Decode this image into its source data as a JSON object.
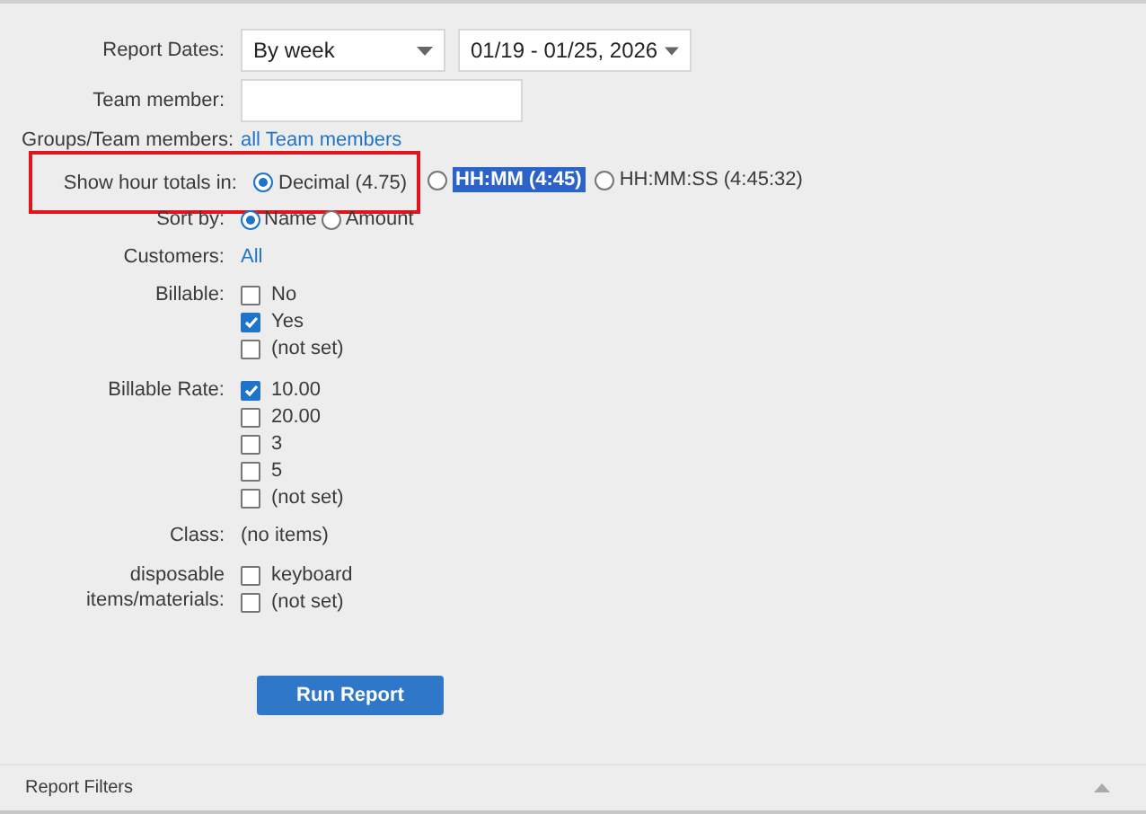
{
  "report_dates": {
    "label": "Report Dates:",
    "period": "By week",
    "range": "01/19 - 01/25, 2026"
  },
  "team_member": {
    "label": "Team member:"
  },
  "groups": {
    "label": "Groups/Team members:",
    "link": "all Team members"
  },
  "hour_totals": {
    "label": "Show hour totals in:",
    "highlighted": true,
    "options": [
      {
        "label": "Decimal (4.75)",
        "selected": true,
        "text_selected": false
      },
      {
        "label": "HH:MM (4:45)",
        "selected": false,
        "text_selected": true
      },
      {
        "label": "HH:MM:SS (4:45:32)",
        "selected": false,
        "text_selected": false
      }
    ]
  },
  "sort_by": {
    "label": "Sort by:",
    "options": [
      {
        "label": "Name",
        "selected": true
      },
      {
        "label": "Amount",
        "selected": false
      }
    ]
  },
  "customers": {
    "label": "Customers:",
    "link": "All"
  },
  "billable": {
    "label": "Billable:",
    "options": [
      {
        "label": "No",
        "checked": false
      },
      {
        "label": "Yes",
        "checked": true
      },
      {
        "label": "(not set)",
        "checked": false
      }
    ]
  },
  "billable_rate": {
    "label": "Billable Rate:",
    "options": [
      {
        "label": "10.00",
        "checked": true
      },
      {
        "label": "20.00",
        "checked": false
      },
      {
        "label": "3",
        "checked": false
      },
      {
        "label": "5",
        "checked": false
      },
      {
        "label": "(not set)",
        "checked": false
      }
    ]
  },
  "class": {
    "label": "Class:",
    "value": "(no items)"
  },
  "materials": {
    "label": "disposable items/materials:",
    "options": [
      {
        "label": "keyboard",
        "checked": false
      },
      {
        "label": "(not set)",
        "checked": false
      }
    ]
  },
  "run_button": "Run Report",
  "footer": {
    "title": "Report Filters"
  }
}
